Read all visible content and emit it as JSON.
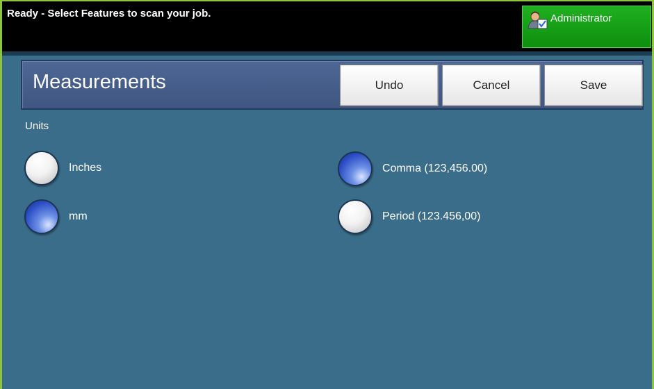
{
  "status_bar": {
    "message": "Ready - Select Features to scan your job.",
    "admin_label": "Administrator",
    "admin_icon": "administrator-user-icon"
  },
  "header": {
    "title": "Measurements",
    "undo_label": "Undo",
    "cancel_label": "Cancel",
    "save_label": "Save"
  },
  "units": {
    "section_label": "Units",
    "options": [
      {
        "label": "Inches",
        "selected": false
      },
      {
        "label": "mm",
        "selected": true
      }
    ]
  },
  "separator": {
    "options": [
      {
        "label": "Comma (123,456.00)",
        "selected": true
      },
      {
        "label": "Period (123.456,00)",
        "selected": false
      }
    ]
  },
  "colors": {
    "background": "#3a6d89",
    "header_panel": "#4e6794",
    "status_bar": "#000000",
    "admin_button": "#1aa21a",
    "frame_border": "#8cc43c",
    "radio_selected": "#2a4cc4"
  }
}
